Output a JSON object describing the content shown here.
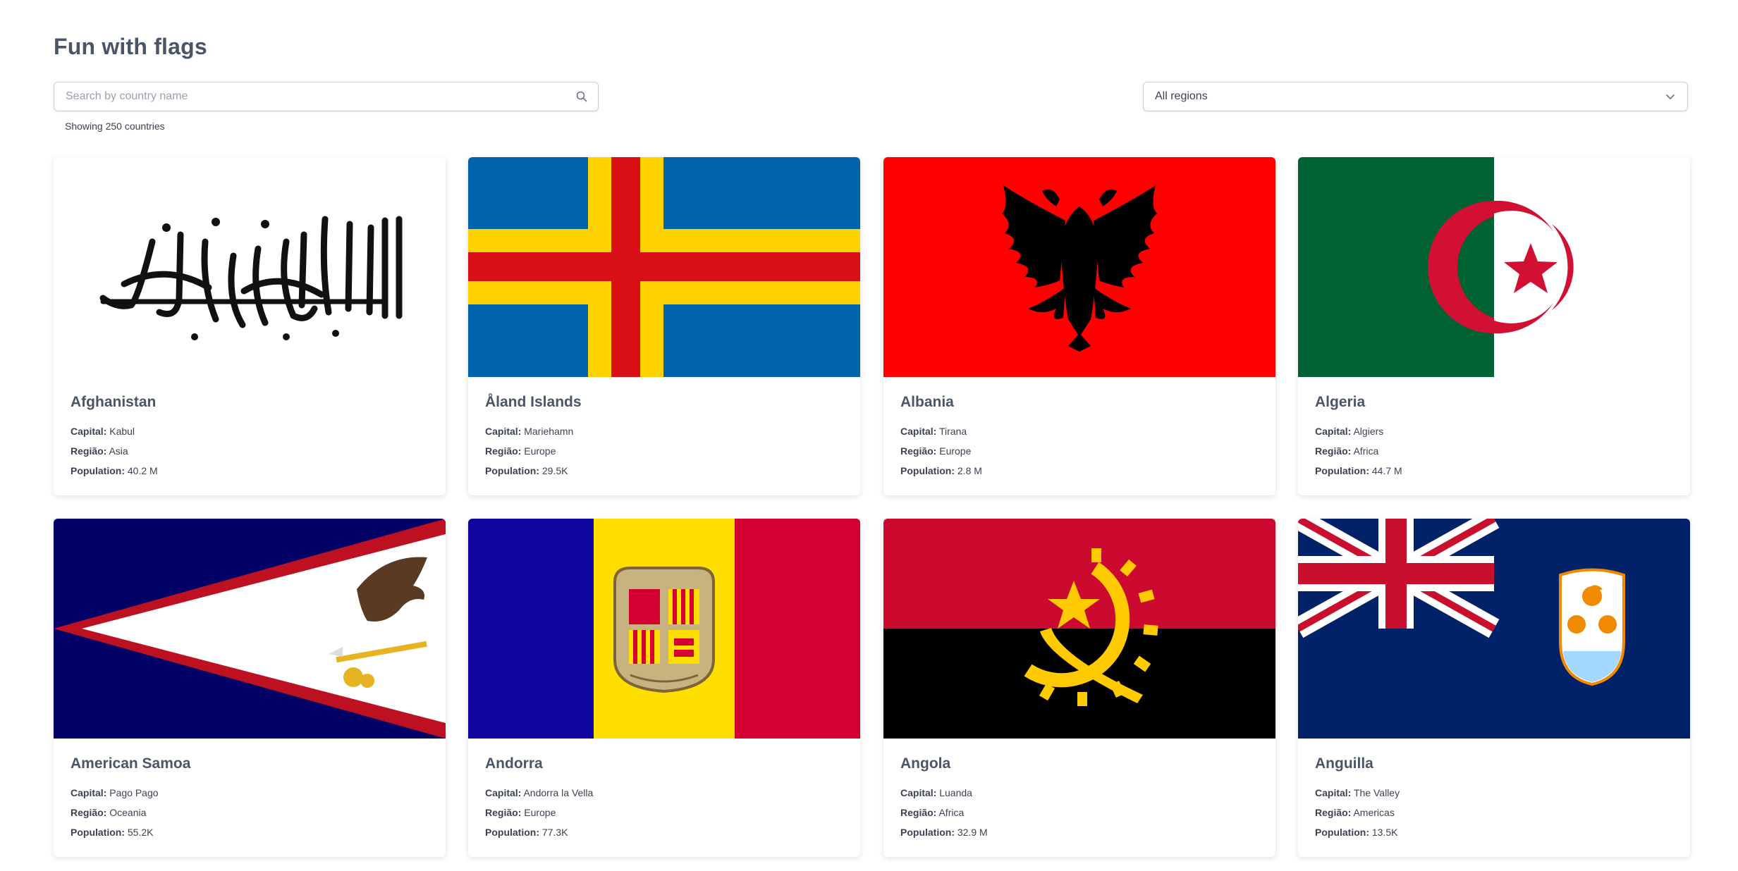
{
  "header": {
    "title": "Fun with flags"
  },
  "search": {
    "placeholder": "Search by country name",
    "value": ""
  },
  "region_filter": {
    "selected": "All regions"
  },
  "results": {
    "count_text": "Showing 250 countries"
  },
  "labels": {
    "capital": "Capital:",
    "region": "Região:",
    "population": "Population:"
  },
  "countries": [
    {
      "name": "Afghanistan",
      "capital": "Kabul",
      "region": "Asia",
      "population": "40.2 M"
    },
    {
      "name": "Åland Islands",
      "capital": "Mariehamn",
      "region": "Europe",
      "population": "29.5K"
    },
    {
      "name": "Albania",
      "capital": "Tirana",
      "region": "Europe",
      "population": "2.8 M"
    },
    {
      "name": "Algeria",
      "capital": "Algiers",
      "region": "Africa",
      "population": "44.7 M"
    },
    {
      "name": "American Samoa",
      "capital": "Pago Pago",
      "region": "Oceania",
      "population": "55.2K"
    },
    {
      "name": "Andorra",
      "capital": "Andorra la Vella",
      "region": "Europe",
      "population": "77.3K"
    },
    {
      "name": "Angola",
      "capital": "Luanda",
      "region": "Africa",
      "population": "32.9 M"
    },
    {
      "name": "Anguilla",
      "capital": "The Valley",
      "region": "Americas",
      "population": "13.5K"
    }
  ],
  "icons": {
    "search": "search-icon",
    "dropdown": "chevron-down-icon"
  }
}
